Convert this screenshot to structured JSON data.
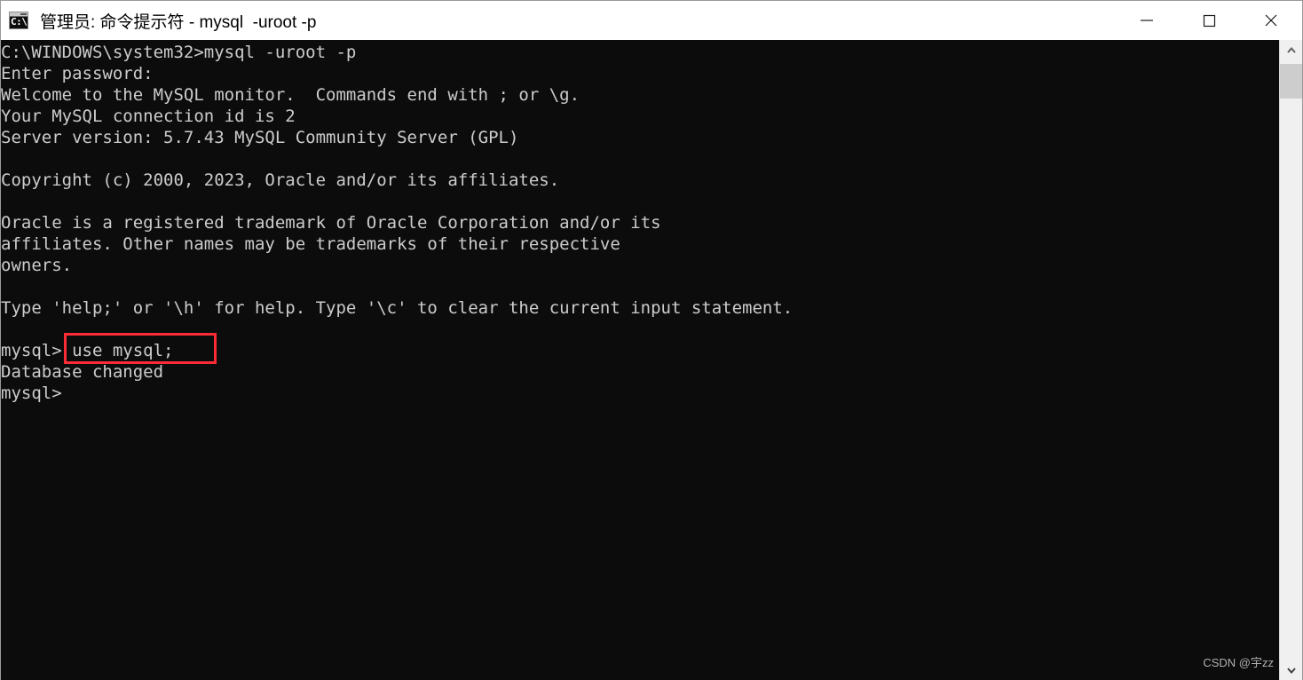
{
  "window": {
    "title": "管理员: 命令提示符 - mysql  -uroot -p",
    "icon": "cmd-console-icon",
    "icon_glyph": "C:\\",
    "controls": {
      "minimize": "minimize-icon",
      "maximize": "maximize-icon",
      "close": "close-icon"
    }
  },
  "terminal": {
    "background_color": "#0c0c0c",
    "text_color": "#cccccc",
    "lines": [
      "C:\\WINDOWS\\system32>mysql -uroot -p",
      "Enter password:",
      "Welcome to the MySQL monitor.  Commands end with ; or \\g.",
      "Your MySQL connection id is 2",
      "Server version: 5.7.43 MySQL Community Server (GPL)",
      "",
      "Copyright (c) 2000, 2023, Oracle and/or its affiliates.",
      "",
      "Oracle is a registered trademark of Oracle Corporation and/or its",
      "affiliates. Other names may be trademarks of their respective",
      "owners.",
      "",
      "Type 'help;' or '\\h' for help. Type '\\c' to clear the current input statement.",
      "",
      "mysql> use mysql;",
      "Database changed",
      "mysql>"
    ]
  },
  "annotation": {
    "highlight_color": "#fb2c36",
    "highlighted_text": "use mysql;"
  },
  "watermark": {
    "text": "CSDN @宇zz"
  },
  "scrollbar": {
    "up_arrow": "chevron-up-icon",
    "down_arrow": "chevron-down-icon",
    "thumb": "scrollbar-thumb"
  }
}
